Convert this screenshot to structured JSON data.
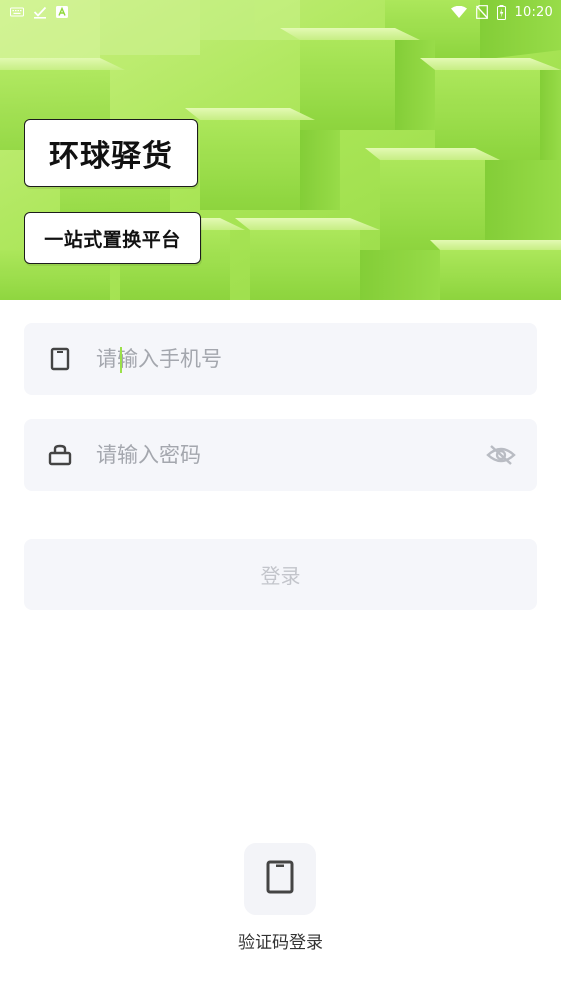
{
  "status_bar": {
    "time": "10:20",
    "left_icons": [
      "keyboard-icon",
      "check-download-icon",
      "app-a-icon"
    ],
    "right_icons": [
      "wifi-icon",
      "no-sim-icon",
      "battery-icon"
    ]
  },
  "hero": {
    "title": "环球驿货",
    "subtitle": "一站式置换平台",
    "background_color": "#9ee24a"
  },
  "form": {
    "phone": {
      "placeholder": "请输入手机号",
      "value": "",
      "icon": "phone-icon"
    },
    "password": {
      "placeholder": "请输入密码",
      "value": "",
      "icon": "lock-icon",
      "toggle_icon": "eye-off-icon"
    },
    "submit_label": "登录"
  },
  "alt_login": {
    "icon": "phone-icon",
    "label": "验证码登录"
  },
  "colors": {
    "accent": "#9be04a",
    "field_bg": "#f5f6fa",
    "placeholder": "#a4a7ae",
    "disabled_text": "#c3c5cb"
  }
}
